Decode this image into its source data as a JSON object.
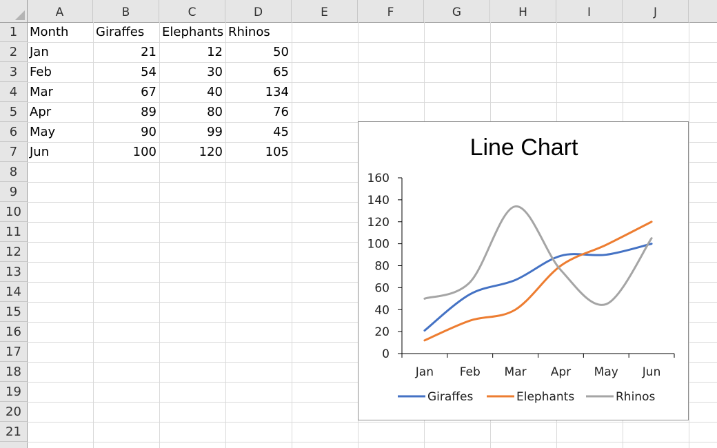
{
  "sheet": {
    "columns": [
      "A",
      "B",
      "C",
      "D",
      "E",
      "F",
      "G",
      "H",
      "I",
      "J"
    ],
    "row_numbers": [
      "1",
      "2",
      "3",
      "4",
      "5",
      "6",
      "7",
      "8",
      "9",
      "10",
      "11",
      "12",
      "13",
      "14",
      "15",
      "16",
      "17",
      "18",
      "19",
      "20",
      "21"
    ],
    "header_row": [
      "Month",
      "Giraffes",
      "Elephants",
      "Rhinos"
    ],
    "data_rows": [
      [
        "Jan",
        "21",
        "12",
        "50"
      ],
      [
        "Feb",
        "54",
        "30",
        "65"
      ],
      [
        "Mar",
        "67",
        "40",
        "134"
      ],
      [
        "Apr",
        "89",
        "80",
        "76"
      ],
      [
        "May",
        "90",
        "99",
        "45"
      ],
      [
        "Jun",
        "100",
        "120",
        "105"
      ]
    ]
  },
  "chart_data": {
    "type": "line",
    "title": "Line Chart",
    "categories": [
      "Jan",
      "Feb",
      "Mar",
      "Apr",
      "May",
      "Jun"
    ],
    "series": [
      {
        "name": "Giraffes",
        "values": [
          21,
          54,
          67,
          89,
          90,
          100
        ],
        "color": "#4472c4"
      },
      {
        "name": "Elephants",
        "values": [
          12,
          30,
          40,
          80,
          99,
          120
        ],
        "color": "#ed7d31"
      },
      {
        "name": "Rhinos",
        "values": [
          50,
          65,
          134,
          76,
          45,
          105
        ],
        "color": "#a5a5a5"
      }
    ],
    "ylim": [
      0,
      160
    ],
    "yticks": [
      "0",
      "20",
      "40",
      "60",
      "80",
      "100",
      "120",
      "140",
      "160"
    ],
    "smooth": true,
    "grid": false,
    "legend_position": "bottom"
  }
}
